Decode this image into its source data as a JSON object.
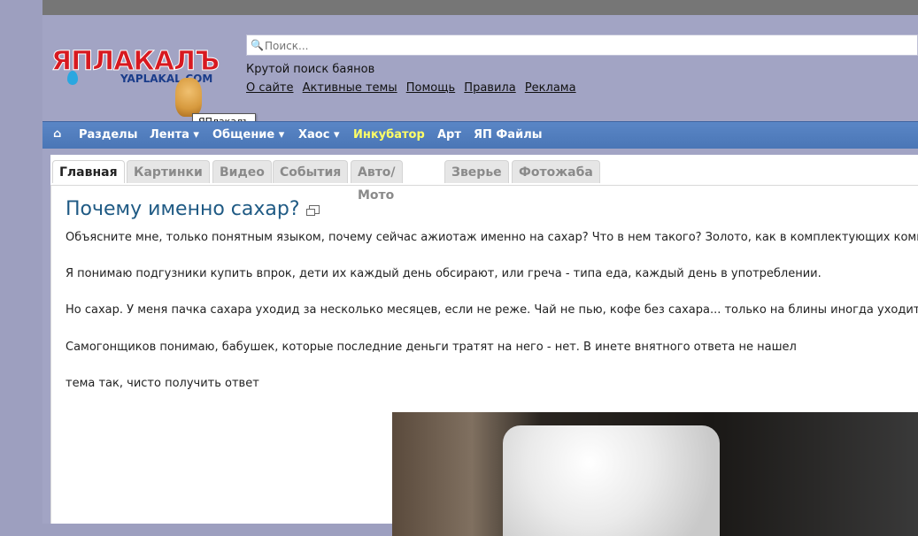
{
  "logo": {
    "brand": "ЯПЛАКАЛЪ",
    "domain": "YAPLAKAL.COM"
  },
  "tooltip": "ЯПлакалъ",
  "search": {
    "placeholder": "Поиск..."
  },
  "tagline": "Крутой поиск баянов",
  "header_links": [
    "О сайте",
    "Активные темы",
    "Помощь",
    "Правила",
    "Реклама"
  ],
  "nav": {
    "home_icon": "home-icon",
    "items": [
      "Разделы",
      "Лента",
      "Общение",
      "Хаос",
      "Инкубатор",
      "Арт",
      "ЯП Файлы"
    ]
  },
  "tabs": [
    "Главная",
    "Картинки",
    "Видео",
    "События",
    "Авто/Мото",
    "Зверье",
    "Фотожаба"
  ],
  "post": {
    "title": "Почему именно сахар?",
    "paragraphs": [
      "Объясните мне, только понятным языком, почему сейчас ажиотаж именно на сахар? Что в нем такого? Золото, как в комплектующих компьюте",
      "Я понимаю подгузники купить впрок, дети их каждый день обсирают, или греча - типа еда, каждый день в употреблении.",
      "Но сахар. У меня пачка сахара уходид за несколько месяцев, если не реже. Чай не пью, кофе без сахара... только на блины иногда уходит, но",
      "Самогонщиков понимаю, бабушек, которые последние деньги тратят на него - нет. В инете внятного ответа не нашел",
      "тема так, чисто получить ответ"
    ]
  },
  "colors": {
    "nav_bg": "#4a76b6",
    "page_bg": "#a2a4c4",
    "title": "#1f5a84",
    "incubator": "#ffff66"
  }
}
